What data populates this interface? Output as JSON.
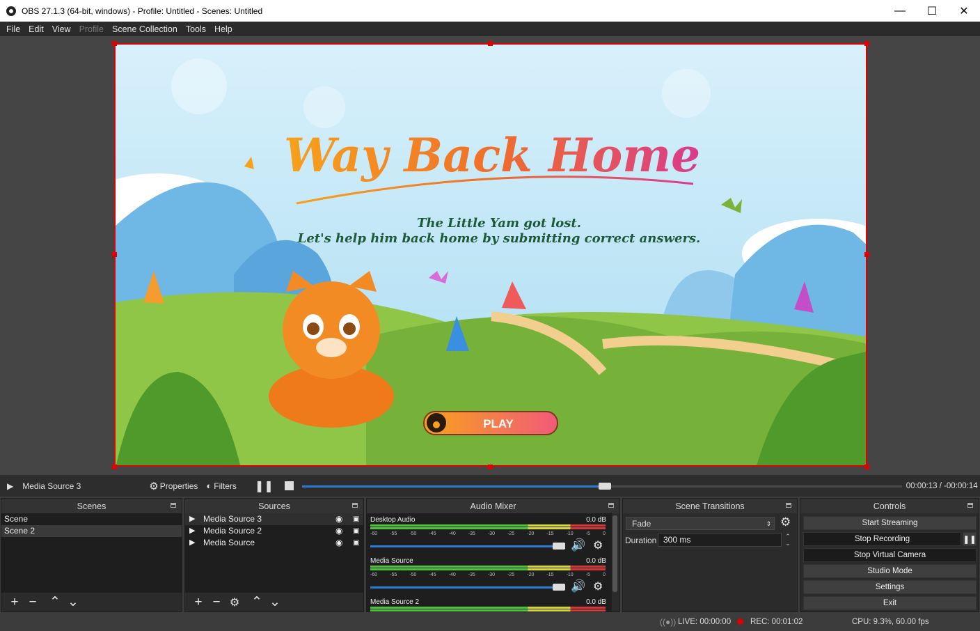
{
  "window": {
    "title": "OBS 27.1.3 (64-bit, windows) - Profile: Untitled - Scenes: Untitled"
  },
  "menu": [
    "File",
    "Edit",
    "View",
    "Profile",
    "Scene Collection",
    "Tools",
    "Help"
  ],
  "menu_disabled": [
    "Profile"
  ],
  "preview": {
    "game_title": "Way Back Home",
    "subtitle_line1": "The Little Yam got lost.",
    "subtitle_line2": "Let's help him back home by submitting correct answers.",
    "play_label": "PLAY"
  },
  "media_controls": {
    "source_name": "Media Source 3",
    "properties_label": "Properties",
    "filters_label": "Filters",
    "time": "00:00:13 / -00:00:14",
    "progress": 0.505
  },
  "scenes": {
    "title": "Scenes",
    "items": [
      "Scene",
      "Scene 2"
    ],
    "selected": "Scene 2"
  },
  "sources": {
    "title": "Sources",
    "items": [
      "Media Source 3",
      "Media Source 2",
      "Media Source"
    ]
  },
  "audio_mixer": {
    "title": "Audio Mixer",
    "tick_labels": [
      "-60",
      "-55",
      "-50",
      "-45",
      "-40",
      "-35",
      "-30",
      "-25",
      "-20",
      "-15",
      "-10",
      "-5",
      "0"
    ],
    "channels": [
      {
        "name": "Desktop Audio",
        "db": "0.0 dB",
        "level": 1.0
      },
      {
        "name": "Media Source",
        "db": "0.0 dB",
        "level": 1.0
      },
      {
        "name": "Media Source 2",
        "db": "0.0 dB",
        "level": 1.0
      }
    ]
  },
  "transitions": {
    "title": "Scene Transitions",
    "selected": "Fade",
    "duration_label": "Duration",
    "duration_value": "300 ms"
  },
  "controls": {
    "title": "Controls",
    "buttons": [
      "Start Streaming",
      "Stop Recording",
      "Stop Virtual Camera",
      "Studio Mode",
      "Settings",
      "Exit"
    ]
  },
  "status": {
    "live": "LIVE: 00:00:00",
    "rec": "REC: 00:01:02",
    "cpu": "CPU: 9.3%, 60.00 fps"
  },
  "colors": {
    "accent": "#2d7dd2",
    "selection_border": "#e00000",
    "rec_dot": "#e00000"
  }
}
